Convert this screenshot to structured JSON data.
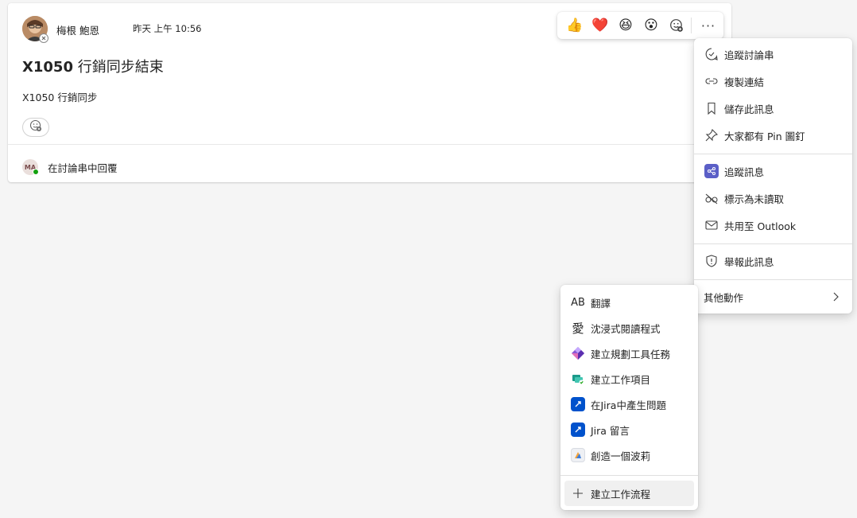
{
  "post": {
    "author": "梅根 鮑恩",
    "timestamp": "昨天 上午 10:56",
    "title_bold": "X1050",
    "title_rest": " 行銷同步結束",
    "body": "X1050 行銷同步",
    "reply_initials": "MA",
    "reply_label": "在討論串中回覆"
  },
  "reactions": {
    "items": [
      "👍",
      "❤️",
      "😆",
      "😮"
    ],
    "add_icon": "emoji-add-icon",
    "more_label": "···"
  },
  "main_menu": {
    "items": [
      {
        "label": "追蹤討論串",
        "icon": "chat-follow-icon"
      },
      {
        "label": "複製連結",
        "icon": "link-icon"
      },
      {
        "label": "儲存此訊息",
        "icon": "bookmark-icon"
      },
      {
        "label": "大家都有 Pin 圖釘",
        "icon": "pin-icon"
      },
      {
        "label": "追蹤訊息",
        "icon": "share-app-icon"
      },
      {
        "label": "標示為未讀取",
        "icon": "glasses-off-icon"
      },
      {
        "label": "共用至 Outlook",
        "icon": "mail-icon"
      },
      {
        "label": "舉報此訊息",
        "icon": "shield-icon"
      }
    ],
    "more_actions": "其他動作"
  },
  "sub_menu": {
    "items": [
      {
        "label": "翻譯",
        "icon": "translate-icon",
        "glyph": "AB"
      },
      {
        "label": "沈浸式閱讀程式",
        "icon": "immersive-reader-icon",
        "glyph": "愛"
      },
      {
        "label": "建立規劃工具任務",
        "icon": "planner-icon"
      },
      {
        "label": "建立工作項目",
        "icon": "work-item-icon"
      },
      {
        "label": "在Jira中產生問題",
        "icon": "jira-icon"
      },
      {
        "label": "Jira 留言",
        "icon": "jira-icon"
      },
      {
        "label": "創造一個波莉",
        "icon": "polly-icon"
      },
      {
        "label": "建立工作流程",
        "icon": "plus-icon"
      }
    ]
  },
  "colors": {
    "accent": "#5b5fc7",
    "jira": "#0052cc",
    "online": "#13a10e"
  }
}
